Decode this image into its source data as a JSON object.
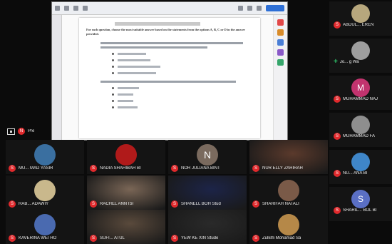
{
  "shared_screen": {
    "paragraph": "For each question, choose the most suitable answer based on the statements from the options A, B, C or D in the answer provided."
  },
  "presenter_strip": {
    "badge": "N",
    "label": "Pre"
  },
  "right_column": [
    {
      "name": "ABDUL... EREN",
      "avatar_color": "#b7a77d",
      "badge": "S",
      "badge_type": "red"
    },
    {
      "name": "Jo... g Wa",
      "avatar_color": "#9e9e9e",
      "badge": "+",
      "badge_type": "green"
    },
    {
      "name": "MUHAMMAD NAJ",
      "avatar_letter": "M",
      "avatar_color": "#c2336e",
      "badge": "S",
      "badge_type": "red"
    },
    {
      "name": "MUHAMMAD FA",
      "avatar_color": "#8e8e8e",
      "badge": "S",
      "badge_type": "red"
    },
    {
      "name": "NU... ANA BI",
      "avatar_color": "#3f86c8",
      "badge": "S",
      "badge_type": "red"
    },
    {
      "name": "SHARIL... BOL BI",
      "avatar_letter": "S",
      "avatar_color": "#5a6fc4",
      "badge": "S",
      "badge_type": "red"
    }
  ],
  "grid": [
    [
      {
        "name": "MU... MAD YASIR",
        "kind": "avatar",
        "avatar_color": "#3a6fa0"
      },
      {
        "name": "NADIA SHAHIBAH BI",
        "kind": "avatar",
        "avatar_color": "#b01a1a"
      },
      {
        "name": "NOR JULIANA BINT",
        "kind": "letter",
        "avatar_letter": "N",
        "avatar_color": "#7a6a5e"
      },
      {
        "name": "NUR ELLY ZAHIRAH",
        "kind": "video",
        "bg": "#5b3a2c"
      }
    ],
    [
      {
        "name": "RAB... ADAWIY",
        "kind": "avatar",
        "avatar_color": "#c9b88c"
      },
      {
        "name": "RACHEL ANN ISI",
        "kind": "video",
        "bg": "#7a6656"
      },
      {
        "name": "SHANELL BOH Stud",
        "kind": "video",
        "bg": "#1c2448"
      },
      {
        "name": "SHARIFAH NATALI",
        "kind": "avatar",
        "avatar_color": "#7a5a48"
      }
    ],
    [
      {
        "name": "KAVERINA WEI HO",
        "kind": "avatar",
        "avatar_color": "#4a6ab0"
      },
      {
        "name": "SUFI... ATUL",
        "kind": "video",
        "bg": "#5a4a3c"
      },
      {
        "name": "YEW KE XIN Stude",
        "kind": "video",
        "bg": "#2a2a2a"
      },
      {
        "name": "Zulkifli Mohamad Sa",
        "kind": "avatar",
        "avatar_color": "#b58848"
      }
    ]
  ],
  "badge_letter": "S",
  "colors": {
    "badge_red": "#e0292c",
    "badge_green": "#2fc56b",
    "background": "#0b0b0b"
  }
}
